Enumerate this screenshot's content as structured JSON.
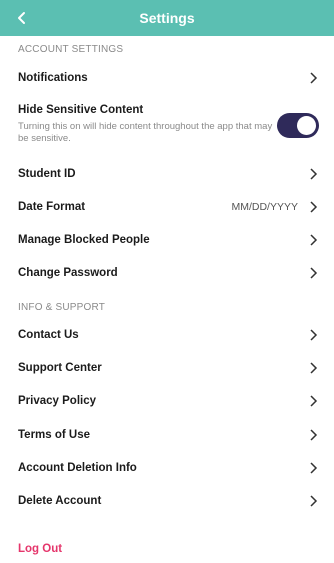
{
  "header": {
    "title": "Settings",
    "back_icon": "chevron-left-icon"
  },
  "account_settings": {
    "section_title": "ACCOUNT SETTINGS",
    "notifications": {
      "label": "Notifications"
    },
    "hide_sensitive": {
      "label": "Hide Sensitive Content",
      "description": "Turning this on will hide content throughout the app that may be sensitive.",
      "enabled": true
    },
    "student_id": {
      "label": "Student ID"
    },
    "date_format": {
      "label": "Date Format",
      "value": "MM/DD/YYYY"
    },
    "manage_blocked": {
      "label": "Manage Blocked People"
    },
    "change_password": {
      "label": "Change Password"
    }
  },
  "info_support": {
    "section_title": "INFO & SUPPORT",
    "contact_us": {
      "label": "Contact Us"
    },
    "support_center": {
      "label": "Support Center"
    },
    "privacy_policy": {
      "label": "Privacy Policy"
    },
    "terms_of_use": {
      "label": "Terms of Use"
    },
    "account_deletion_info": {
      "label": "Account Deletion Info"
    },
    "delete_account": {
      "label": "Delete Account"
    }
  },
  "logout": {
    "label": "Log Out"
  },
  "colors": {
    "header_bg": "#5bbfb2",
    "toggle_on": "#2f2a5a",
    "logout_text": "#e5356b",
    "section_text": "#8a8a8a"
  }
}
